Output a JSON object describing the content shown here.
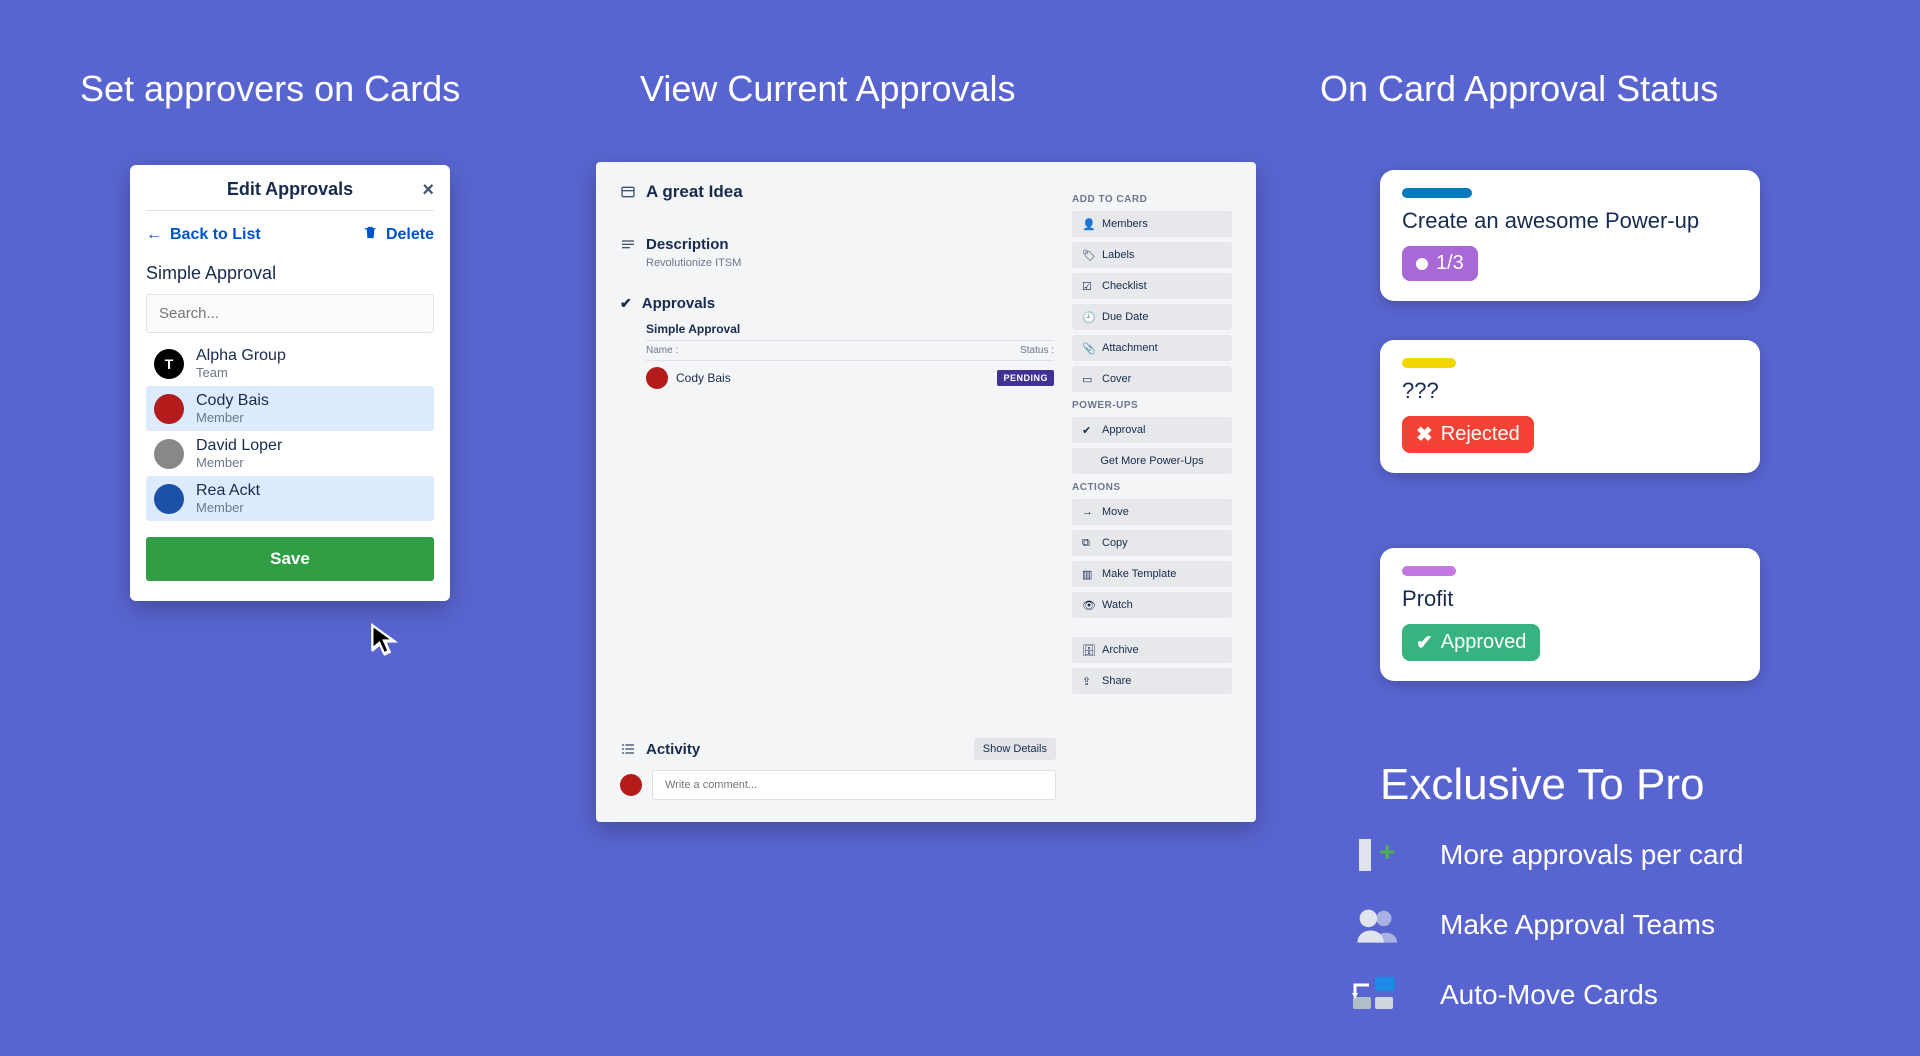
{
  "headings": {
    "col1": "Set approvers on Cards",
    "col2": "View Current Approvals",
    "col3": "On Card Approval Status"
  },
  "panel1": {
    "title": "Edit Approvals",
    "back": "Back to List",
    "delete": "Delete",
    "subheading": "Simple Approval",
    "search_placeholder": "Search...",
    "items": [
      {
        "name": "Alpha Group",
        "sub": "Team"
      },
      {
        "name": "Cody Bais",
        "sub": "Member"
      },
      {
        "name": "David Loper",
        "sub": "Member"
      },
      {
        "name": "Rea Ackt",
        "sub": "Member"
      }
    ],
    "save": "Save"
  },
  "panel2": {
    "title": "A great Idea",
    "desc_head": "Description",
    "desc_text": "Revolutionize ITSM",
    "approvals_head": "Approvals",
    "approval_subhead": "Simple Approval",
    "table_name": "Name :",
    "table_status": "Status :",
    "row_name": "Cody Bais",
    "row_status": "PENDING",
    "activity_head": "Activity",
    "show_details": "Show Details",
    "comment_placeholder": "Write a comment...",
    "side": {
      "add_head": "ADD TO CARD",
      "members": "Members",
      "labels": "Labels",
      "checklist": "Checklist",
      "duedate": "Due Date",
      "attachment": "Attachment",
      "cover": "Cover",
      "powerups_head": "POWER-UPS",
      "approval": "Approval",
      "getmore": "Get More Power-Ups",
      "actions_head": "ACTIONS",
      "move": "Move",
      "copy": "Copy",
      "template": "Make Template",
      "watch": "Watch",
      "archive": "Archive",
      "share": "Share"
    }
  },
  "panel3": {
    "card1_title": "Create an awesome Power-up",
    "card1_badge": "1/3",
    "card2_title": "???",
    "card2_badge": "Rejected",
    "card3_title": "Profit",
    "card3_badge": "Approved"
  },
  "exclusive": {
    "title": "Exclusive To Pro",
    "items": [
      "More approvals per card",
      "Make Approval Teams",
      "Auto-Move Cards"
    ]
  }
}
